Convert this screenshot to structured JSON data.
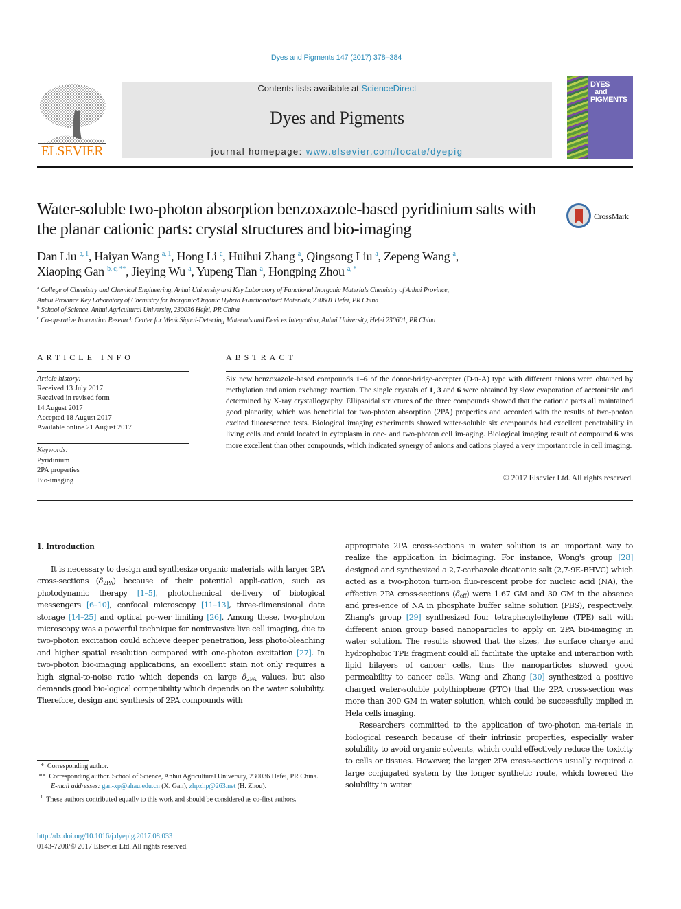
{
  "header": {
    "journal_ref": "Dyes and Pigments 147 (2017) 378–384",
    "contents_prefix": "Contents lists available at ",
    "contents_link": "ScienceDirect",
    "journal_title": "Dyes and Pigments",
    "homepage_prefix": "journal homepage: ",
    "homepage_link": "www.elsevier.com/locate/dyepig",
    "publisher_logo_text": "ELSEVIER",
    "cover_title_lines": [
      "DYES",
      "and",
      "PIGMENTS"
    ],
    "crossmark_label": "CrossMark"
  },
  "colors": {
    "link": "#2a8bb8",
    "elsevier_orange": "#f07c00",
    "masthead_bg": "#e6e6e6",
    "cover_purple": "#6e65b2"
  },
  "article": {
    "title": "Water-soluble two-photon absorption benzoxazole-based pyridinium salts with the planar cationic parts: crystal structures and bio-imaging",
    "authors": [
      {
        "name": "Dan Liu",
        "sup": "a, 1",
        "sep": ", "
      },
      {
        "name": "Haiyan Wang",
        "sup": "a, 1",
        "sep": ", "
      },
      {
        "name": "Hong Li",
        "sup": "a",
        "sep": ", "
      },
      {
        "name": "Huihui Zhang",
        "sup": "a",
        "sep": ", "
      },
      {
        "name": "Qingsong Liu",
        "sup": "a",
        "sep": ", "
      },
      {
        "name": "Zepeng Wang",
        "sup": "a",
        "sep": ","
      },
      {
        "name": "Xiaoping Gan",
        "sup": "b, c, **",
        "sep": ", "
      },
      {
        "name": "Jieying Wu",
        "sup": "a",
        "sep": ", "
      },
      {
        "name": "Yupeng Tian",
        "sup": "a",
        "sep": ", "
      },
      {
        "name": "Hongping Zhou",
        "sup": "a, *",
        "sep": ""
      }
    ],
    "affiliations": [
      {
        "key": "a",
        "text": "College of Chemistry and Chemical Engineering, Anhui University and Key Laboratory of Functional Inorganic Materials Chemistry of Anhui Province,"
      },
      {
        "key": "",
        "text": "Anhui Province Key Laboratory of Chemistry for Inorganic/Organic Hybrid Functionalized Materials, 230601 Hefei, PR China"
      },
      {
        "key": "b",
        "text": "School of Science, Anhui Agricultural University, 230036 Hefei, PR China"
      },
      {
        "key": "c",
        "text": "Co-operative Innovation Research Center for Weak Signal-Detecting Materials and Devices Integration, Anhui University, Hefei 230601, PR China"
      }
    ]
  },
  "article_info": {
    "heading": "ARTICLE INFO",
    "history_label": "Article history:",
    "history": [
      "Received 13 July 2017",
      "Received in revised form",
      "14 August 2017",
      "Accepted 18 August 2017",
      "Available online 21 August 2017"
    ],
    "keywords_label": "Keywords:",
    "keywords": [
      "Pyridinium",
      "2PA properties",
      "Bio-imaging"
    ]
  },
  "abstract": {
    "heading": "ABSTRACT",
    "parts": [
      {
        "t": "Six new benzoxazole-based compounds ",
        "b": false
      },
      {
        "t": "1",
        "b": true
      },
      {
        "t": "–",
        "b": false
      },
      {
        "t": "6",
        "b": true
      },
      {
        "t": " of the donor-bridge-accepter (D-π-A) type with different anions were obtained by methylation and anion exchange reaction. The single crystals of ",
        "b": false
      },
      {
        "t": "1",
        "b": true
      },
      {
        "t": ", ",
        "b": false
      },
      {
        "t": "3",
        "b": true
      },
      {
        "t": " and ",
        "b": false
      },
      {
        "t": "6",
        "b": true
      },
      {
        "t": " were obtained by slow evaporation of acetonitrile and determined by X-ray crystallography. Ellipsoidal structures of the three compounds showed that the cationic parts all maintained good planarity, which was beneficial for two-photon absorption (2PA) properties and accorded with the results of two-photon excited fluorescence tests. Biological imaging experiments showed water-soluble six compounds had excellent penetrability in living cells and could located in cytoplasm in one- and two-photon cell im-aging. Biological imaging result of compound ",
        "b": false
      },
      {
        "t": "6",
        "b": true
      },
      {
        "t": " was more excellent than other compounds, which indicated synergy of anions and cations played a very important role in cell imaging.",
        "b": false
      }
    ],
    "copyright": "© 2017 Elsevier Ltd. All rights reserved."
  },
  "intro": {
    "heading": "1.  Introduction",
    "left_paragraph": [
      {
        "t": "It is necessary to design and synthesize organic materials with larger 2PA cross-sections ("
      },
      {
        "t": "δ",
        "sub": "2PA"
      },
      {
        "t": ") because of their potential appli-cation, such as photodynamic therapy "
      },
      {
        "t": "[1–5]",
        "link": true
      },
      {
        "t": ", photochemical de-livery of biological messengers "
      },
      {
        "t": "[6–10]",
        "link": true
      },
      {
        "t": ", confocal microscopy "
      },
      {
        "t": "[11–13]",
        "link": true
      },
      {
        "t": ", three-dimensional date storage "
      },
      {
        "t": "[14–25]",
        "link": true
      },
      {
        "t": " and optical po-wer limiting "
      },
      {
        "t": "[26]",
        "link": true
      },
      {
        "t": ". Among these, two-photon microscopy was a powerful technique for noninvasive live cell imaging, due to two-photon excitation could achieve deeper penetration, less photo-bleaching and higher spatial resolution compared with one-photon excitation "
      },
      {
        "t": "[27]",
        "link": true
      },
      {
        "t": ". In two-photon bio-imaging applications, an excellent stain not only requires a high signal-to-noise ratio which depends on large "
      },
      {
        "t": "δ",
        "sub": "2PA"
      },
      {
        "t": " values, but also demands good bio-logical compatibility which depends on the water solubility. Therefore, design and synthesis of 2PA compounds with"
      }
    ],
    "right_paragraph_1": [
      {
        "t": "appropriate 2PA cross-sections in water solution is an important way to realize the application in bioimaging. For instance, Wong's group "
      },
      {
        "t": "[28]",
        "link": true
      },
      {
        "t": " designed and synthesized a 2,7-carbazole dicationic salt (2,7-9E-BHVC) which acted as a two-photon turn-on fluo-rescent probe for nucleic acid (NA), the effective 2PA cross-sections ("
      },
      {
        "t": "δ",
        "sub": "eff"
      },
      {
        "t": ") were 1.67 GM and 30 GM in the absence and pres-ence of NA in phosphate buffer saline solution (PBS), respectively. Zhang's group "
      },
      {
        "t": "[29]",
        "link": true
      },
      {
        "t": " synthesized four tetraphenylethylene (TPE) salt with different anion group based nanoparticles to apply on 2PA bio-imaging in water solution. The results showed that the sizes, the surface charge and hydrophobic TPE fragment could all facilitate the uptake and interaction with lipid bilayers of cancer cells, thus the nanoparticles showed good permeability to cancer cells. Wang and Zhang "
      },
      {
        "t": "[30]",
        "link": true
      },
      {
        "t": " synthesized a positive charged water-soluble polythiophene (PTO) that the 2PA cross-section was more than 300 GM in water solution, which could be successfully implied in Hela cells imaging."
      }
    ],
    "right_paragraph_2": "Researchers committed to the application of two-photon ma-terials in biological research because of their intrinsic properties, especially water solubility to avoid organic solvents, which could effectively reduce the toxicity to cells or tissues. However, the larger 2PA cross-sections usually required a large conjugated system by the longer synthetic route, which lowered the solubility in water"
  },
  "footnotes": {
    "star": {
      "mark": "*",
      "text": "Corresponding author."
    },
    "double_star": {
      "mark": "**",
      "text": "Corresponding author. School of Science, Anhui Agricultural University, 230036 Hefei, PR China."
    },
    "email_label": "E-mail addresses:",
    "emails": [
      {
        "address": "gan-xp@ahau.edu.cn",
        "who": "(X. Gan)"
      },
      {
        "address": "zhpzhp@263.net",
        "who": "(H. Zhou)."
      }
    ],
    "equal": {
      "mark": "1",
      "text": "These authors contributed equally to this work and should be considered as co-first authors."
    },
    "doi": "http://dx.doi.org/10.1016/j.dyepig.2017.08.033",
    "issn_line": "0143-7208/© 2017 Elsevier Ltd. All rights reserved."
  }
}
